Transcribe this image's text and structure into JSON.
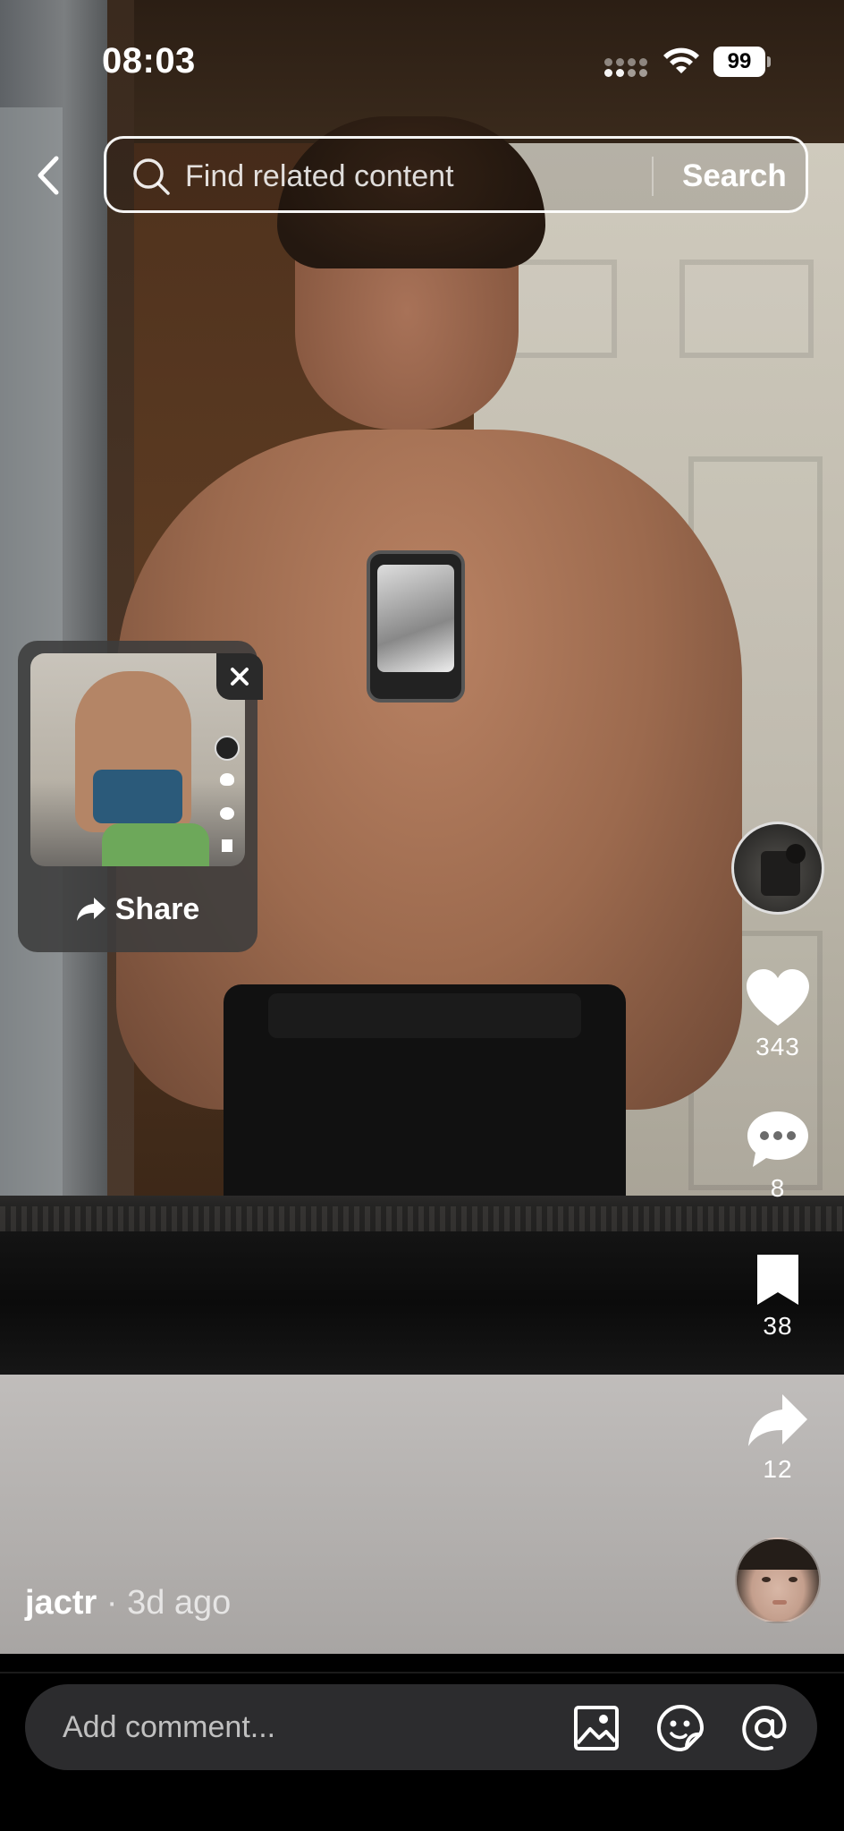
{
  "status_bar": {
    "time": "08:03",
    "battery": "99"
  },
  "search": {
    "placeholder": "Find related content",
    "button_label": "Search"
  },
  "share_popup": {
    "label": "Share"
  },
  "actions": {
    "likes": "343",
    "comments": "8",
    "saves": "38",
    "shares": "12"
  },
  "post": {
    "author": "jactr",
    "separator": "·",
    "age": "3d ago"
  },
  "comment_bar": {
    "placeholder": "Add comment..."
  },
  "icons": [
    "back-chevron-icon",
    "search-icon",
    "share-arrow-icon",
    "close-icon",
    "heart-icon",
    "comment-bubble-icon",
    "bookmark-icon",
    "share-icon",
    "image-icon",
    "sticker-icon",
    "mention-icon"
  ]
}
